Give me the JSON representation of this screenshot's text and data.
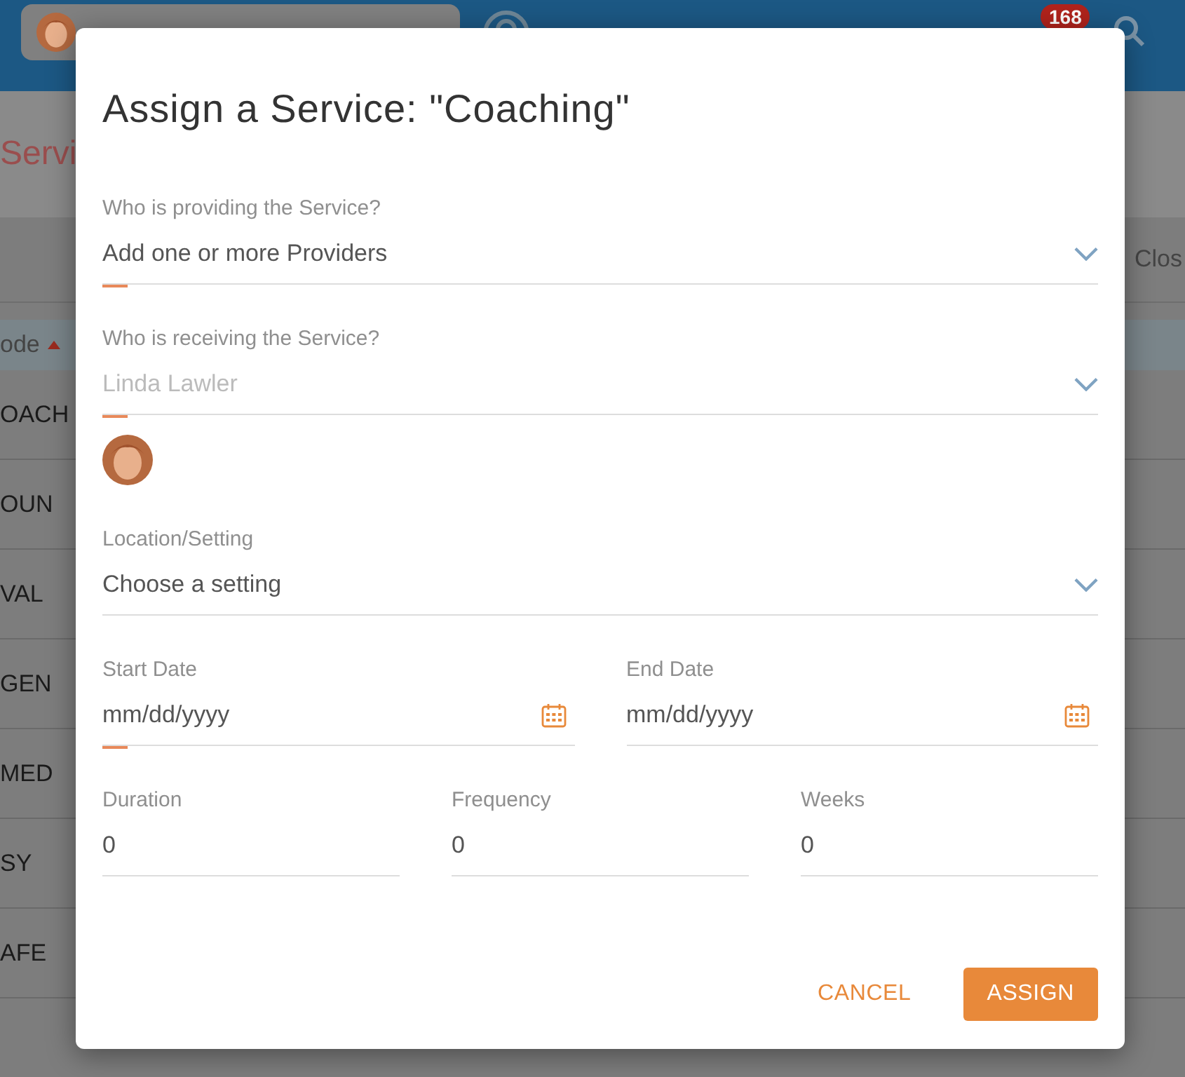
{
  "header": {
    "notification_count": "168"
  },
  "background": {
    "page_title": "Servi",
    "toolbar_action": "Clos",
    "table": {
      "column": "ode",
      "sort_ascending": true,
      "rows": [
        "OACH",
        "OUN",
        "VAL",
        "GEN",
        "MED",
        "SY",
        "AFE"
      ]
    }
  },
  "dialog": {
    "title": "Assign a Service: \"Coaching\"",
    "rows": [
      {
        "fields": [
          {
            "kind": "select",
            "label": "Who is providing the Service?",
            "value": "Add one or more Providers",
            "marked": true,
            "disabled": false
          }
        ]
      },
      {
        "fields": [
          {
            "kind": "select",
            "label": "Who is receiving the Service?",
            "value": "Linda Lawler",
            "marked": true,
            "disabled": true,
            "has_avatar": true
          }
        ]
      },
      {
        "fields": [
          {
            "kind": "select",
            "label": "Location/Setting",
            "value": "Choose a setting",
            "marked": false,
            "disabled": false
          }
        ]
      },
      {
        "fields": [
          {
            "kind": "date",
            "label": "Start Date",
            "value": "mm/dd/yyyy",
            "marked": true,
            "disabled": false
          },
          {
            "kind": "date",
            "label": "End Date",
            "value": "mm/dd/yyyy",
            "marked": false,
            "disabled": false
          }
        ]
      },
      {
        "fields": [
          {
            "kind": "number",
            "label": "Duration",
            "value": "0",
            "marked": false,
            "disabled": false
          },
          {
            "kind": "number",
            "label": "Frequency",
            "value": "0",
            "marked": false,
            "disabled": false
          },
          {
            "kind": "number",
            "label": "Weeks",
            "value": "0",
            "marked": false,
            "disabled": false
          }
        ]
      }
    ],
    "buttons": [
      {
        "kind": "text",
        "label": "CANCEL"
      },
      {
        "kind": "filled",
        "label": "ASSIGN"
      }
    ]
  }
}
